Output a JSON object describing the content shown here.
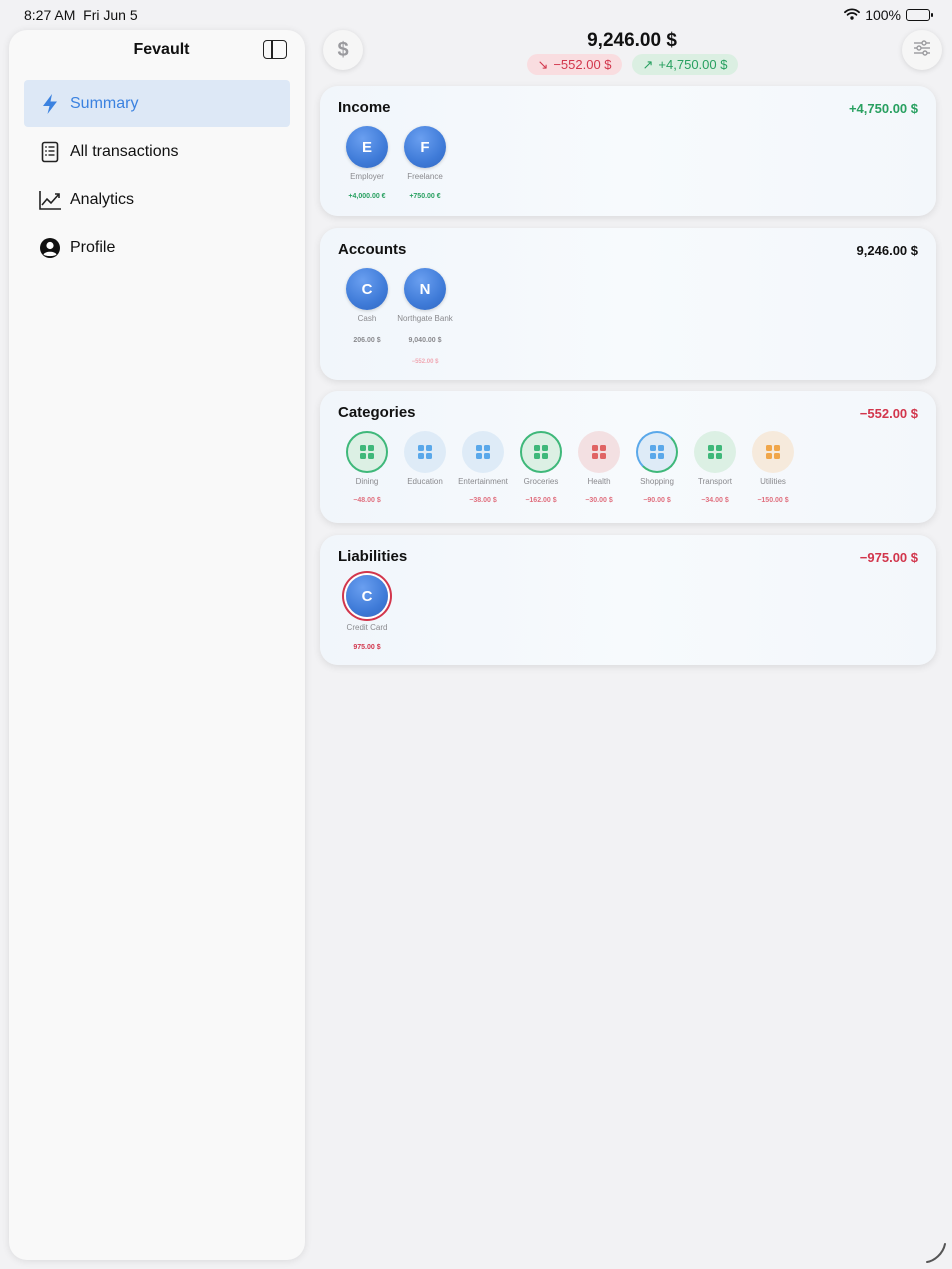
{
  "status": {
    "time": "8:27 AM",
    "date": "Fri Jun 5",
    "battery": "100%"
  },
  "sidebar": {
    "title": "Fevault",
    "items": [
      {
        "label": "Summary",
        "icon": "bolt-icon",
        "active": true
      },
      {
        "label": "All transactions",
        "icon": "list-icon",
        "active": false
      },
      {
        "label": "Analytics",
        "icon": "chart-icon",
        "active": false
      },
      {
        "label": "Profile",
        "icon": "person-icon",
        "active": false
      }
    ]
  },
  "header": {
    "currency_symbol": "$",
    "total": "9,246.00 $",
    "expense": "−552.00 $",
    "income": "+4,750.00 $"
  },
  "income": {
    "title": "Income",
    "total": "+4,750.00 $",
    "items": [
      {
        "initial": "E",
        "name": "Employer",
        "amount": "+4,000.00 €"
      },
      {
        "initial": "F",
        "name": "Freelance",
        "amount": "+750.00 €"
      }
    ]
  },
  "accounts": {
    "title": "Accounts",
    "total": "9,246.00 $",
    "items": [
      {
        "initial": "C",
        "name": "Cash",
        "amount": "206.00 $",
        "change": ""
      },
      {
        "initial": "N",
        "name": "Northgate Bank",
        "amount": "9,040.00 $",
        "change": "−552.00 $"
      }
    ]
  },
  "categories": {
    "title": "Categories",
    "total": "−552.00 $",
    "items": [
      {
        "name": "Dining",
        "amount": "−48.00 $",
        "color": "#3fb87a"
      },
      {
        "name": "Education",
        "amount": "",
        "color": "#5aa8ea"
      },
      {
        "name": "Entertainment",
        "amount": "−38.00 $",
        "color": "#5aa8ea"
      },
      {
        "name": "Groceries",
        "amount": "−162.00 $",
        "color": "#3fb87a"
      },
      {
        "name": "Health",
        "amount": "−30.00 $",
        "color": "#e06464"
      },
      {
        "name": "Shopping",
        "amount": "−90.00 $",
        "color": "#5aa8ea"
      },
      {
        "name": "Transport",
        "amount": "−34.00 $",
        "color": "#3fb87a"
      },
      {
        "name": "Utilities",
        "amount": "−150.00 $",
        "color": "#f0a64a"
      }
    ]
  },
  "liabilities": {
    "title": "Liabilities",
    "total": "−975.00 $",
    "items": [
      {
        "initial": "C",
        "name": "Credit Card",
        "amount": "975.00 $"
      }
    ]
  },
  "colors": {
    "accent": "#3b82e0",
    "positive": "#28a060",
    "negative": "#d2364c"
  }
}
